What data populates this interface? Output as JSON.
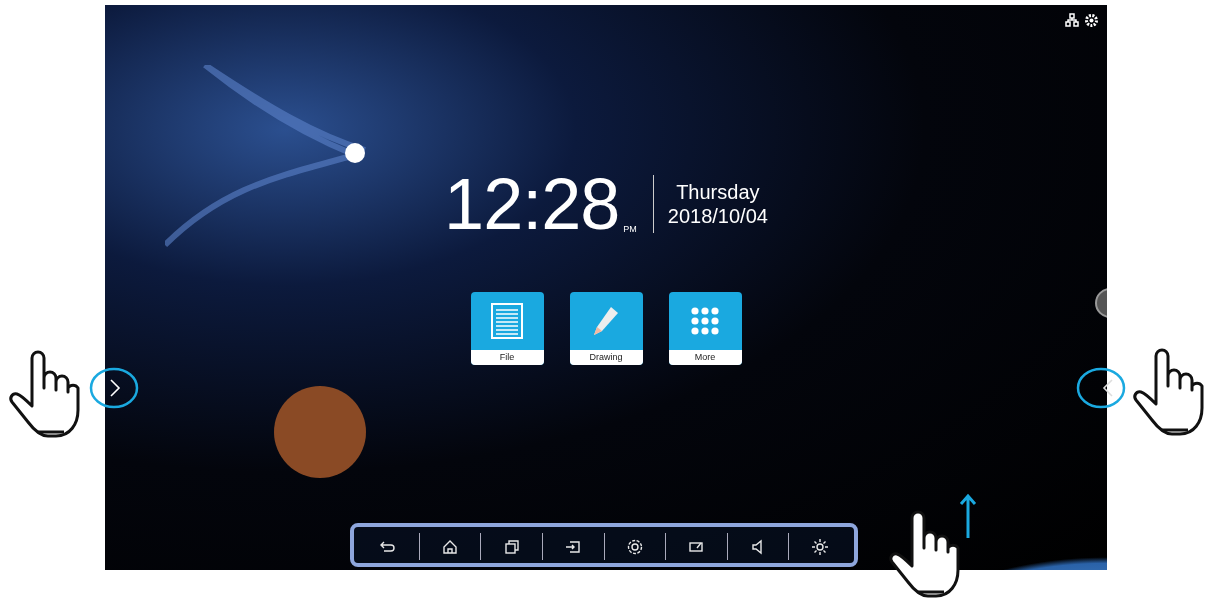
{
  "clock": {
    "time": "12:28",
    "period": "PM",
    "day": "Thursday",
    "date": "2018/10/04"
  },
  "apps": [
    {
      "kind": "file",
      "label": "File"
    },
    {
      "kind": "drawing",
      "label": "Drawing"
    },
    {
      "kind": "more",
      "label": "More"
    }
  ]
}
